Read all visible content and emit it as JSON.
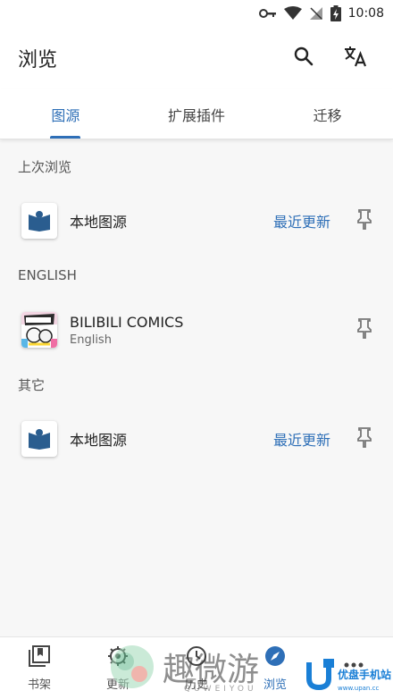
{
  "status_bar": {
    "time": "10:08",
    "icons": [
      "key-icon",
      "wifi-icon",
      "signal-off-icon",
      "battery-charging-icon"
    ]
  },
  "app_bar": {
    "title": "浏览",
    "actions": [
      "search-icon",
      "translate-icon"
    ]
  },
  "tabs": [
    {
      "label": "图源",
      "active": true
    },
    {
      "label": "扩展插件",
      "active": false
    },
    {
      "label": "迁移",
      "active": false
    }
  ],
  "sections": [
    {
      "header": "上次浏览",
      "sources": [
        {
          "name": "本地图源",
          "subtitle": "",
          "action": "最近更新",
          "icon": "local-source-icon"
        }
      ]
    },
    {
      "header": "ENGLISH",
      "sources": [
        {
          "name": "BILIBILI COMICS",
          "subtitle": "English",
          "action": "",
          "icon": "bilibili-comics-icon"
        }
      ]
    },
    {
      "header": "其它",
      "sources": [
        {
          "name": "本地图源",
          "subtitle": "",
          "action": "最近更新",
          "icon": "local-source-icon"
        }
      ]
    }
  ],
  "bottom_nav": [
    {
      "label": "书架",
      "icon": "library-icon",
      "active": false
    },
    {
      "label": "更新",
      "icon": "updates-icon",
      "active": false
    },
    {
      "label": "历史",
      "icon": "history-icon",
      "active": false
    },
    {
      "label": "浏览",
      "icon": "browse-icon",
      "active": true
    },
    {
      "label": "",
      "icon": "more-icon",
      "active": false
    }
  ],
  "watermark": {
    "text": "趣微游",
    "sub": "QUWEIYOU"
  },
  "badge": {
    "text": "优盘手机站",
    "url": "www.upan.cc"
  },
  "colors": {
    "accent": "#2e6fb7",
    "background": "#f7f7f7",
    "surface": "#ffffff",
    "text": "#222222",
    "muted": "#555555"
  }
}
